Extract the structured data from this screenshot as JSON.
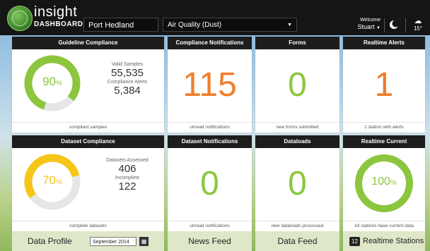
{
  "header": {
    "logo_text_line1": "insight",
    "logo_text_line2": "DASHBOARD",
    "site_select": "Port Hedland",
    "metric_select": "Air Quality (Dust)",
    "welcome_label": "Welcome",
    "user_name": "Stuart",
    "temperature": "15°"
  },
  "panels": {
    "guideline": {
      "title": "Guideline Compliance",
      "percent": "90",
      "percent_value": 0.9,
      "percent_unit": "%",
      "valid_samples_label": "Valid Samples",
      "valid_samples_value": "55,535",
      "alerts_label": "Compliance Alerts",
      "alerts_value": "5,384",
      "footer": "compliant samples"
    },
    "dataset": {
      "title": "Dataset Compliance",
      "percent": "70",
      "percent_value": 0.7,
      "percent_unit": "%",
      "assessed_label": "Datasets Assessed",
      "assessed_value": "406",
      "incomplete_label": "Incomplete",
      "incomplete_value": "122",
      "footer": "complete datasets"
    },
    "compliance_notifications": {
      "title": "Compliance Notifications",
      "value": "115",
      "footer": "unread notifications"
    },
    "forms": {
      "title": "Forms",
      "value": "0",
      "footer": "new forms submitted"
    },
    "realtime_alerts": {
      "title": "Realtime Alerts",
      "value": "1",
      "footer": "1 station with alerts"
    },
    "dataset_notifications": {
      "title": "Dataset Notifications",
      "value": "0",
      "footer": "unread notifications"
    },
    "dataloads": {
      "title": "Dataloads",
      "value": "0",
      "footer": "new dataloads processed"
    },
    "realtime_current": {
      "title": "Realtime Current",
      "percent": "100",
      "percent_value": 1.0,
      "percent_unit": "%",
      "footer": "All stations have current data"
    }
  },
  "bottom": {
    "data_profile_label": "Data Profile",
    "data_profile_date": "September 2014",
    "news_feed_label": "News Feed",
    "data_feed_label": "Data Feed",
    "stations_count": "12",
    "stations_label": "Realtime Stations"
  },
  "colors": {
    "green": "#8cc63f",
    "yellow": "#f5c518",
    "orange": "#f07d2b",
    "gray": "#e6e6e6"
  }
}
